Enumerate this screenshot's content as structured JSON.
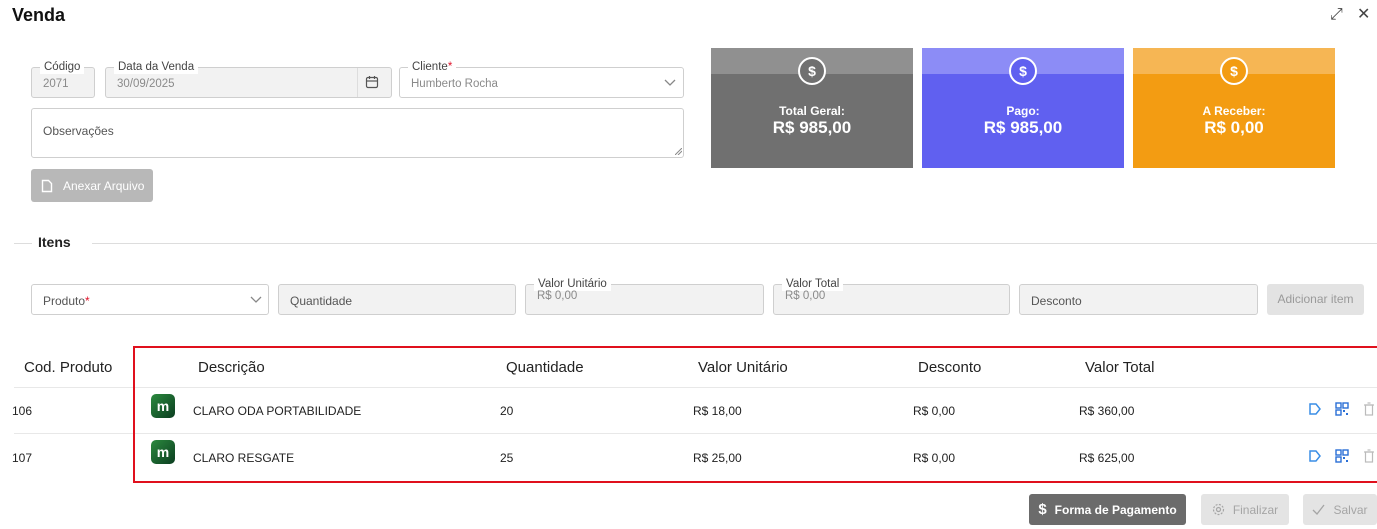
{
  "modal": {
    "title": "Venda",
    "expand_icon": "⤢",
    "close_icon": "✕"
  },
  "form": {
    "codigo": {
      "label": "Código",
      "value": "2071"
    },
    "data_venda": {
      "label": "Data da Venda",
      "value": "30/09/2025",
      "icon": "calendar-icon"
    },
    "cliente": {
      "label": "Cliente",
      "required_mark": "*",
      "value": "Humberto Rocha"
    },
    "observacoes": {
      "placeholder": "Observações"
    },
    "attach_label": "Anexar Arquivo"
  },
  "cards": [
    {
      "label": "Total Geral:",
      "value": "R$ 985,00",
      "symbol": "$",
      "color": "#707070",
      "band": "#909090"
    },
    {
      "label": "Pago:",
      "value": "R$ 985,00",
      "symbol": "$",
      "color": "#6060f0",
      "band": "#8c8cf6"
    },
    {
      "label": "A Receber:",
      "value": "R$ 0,00",
      "symbol": "$",
      "color": "#f39c12",
      "band": "#f6b654"
    }
  ],
  "items": {
    "section_title": "Itens",
    "produto": {
      "placeholder": "Produto",
      "required_mark": "*"
    },
    "quantidade": {
      "placeholder": "Quantidade"
    },
    "valor_unitario": {
      "label": "Valor Unitário",
      "value": "R$ 0,00"
    },
    "valor_total": {
      "label": "Valor Total",
      "value": "R$ 0,00"
    },
    "desconto": {
      "placeholder": "Desconto"
    },
    "add_label": "Adicionar item"
  },
  "table": {
    "headers": [
      "Cod. Produto",
      "Descrição",
      "Quantidade",
      "Valor Unitário",
      "Desconto",
      "Valor Total"
    ],
    "rows": [
      {
        "cod": "106",
        "descricao": "CLARO ODA PORTABILIDADE",
        "quantidade": "20",
        "valor_unitario": "R$ 18,00",
        "desconto": "R$ 0,00",
        "valor_total": "R$ 360,00"
      },
      {
        "cod": "107",
        "descricao": "CLARO RESGATE",
        "quantidade": "25",
        "valor_unitario": "R$ 25,00",
        "desconto": "R$ 0,00",
        "valor_total": "R$ 625,00"
      }
    ]
  },
  "footer": {
    "forma_pagamento": "Forma de Pagamento",
    "finalizar": "Finalizar",
    "salvar": "Salvar"
  }
}
